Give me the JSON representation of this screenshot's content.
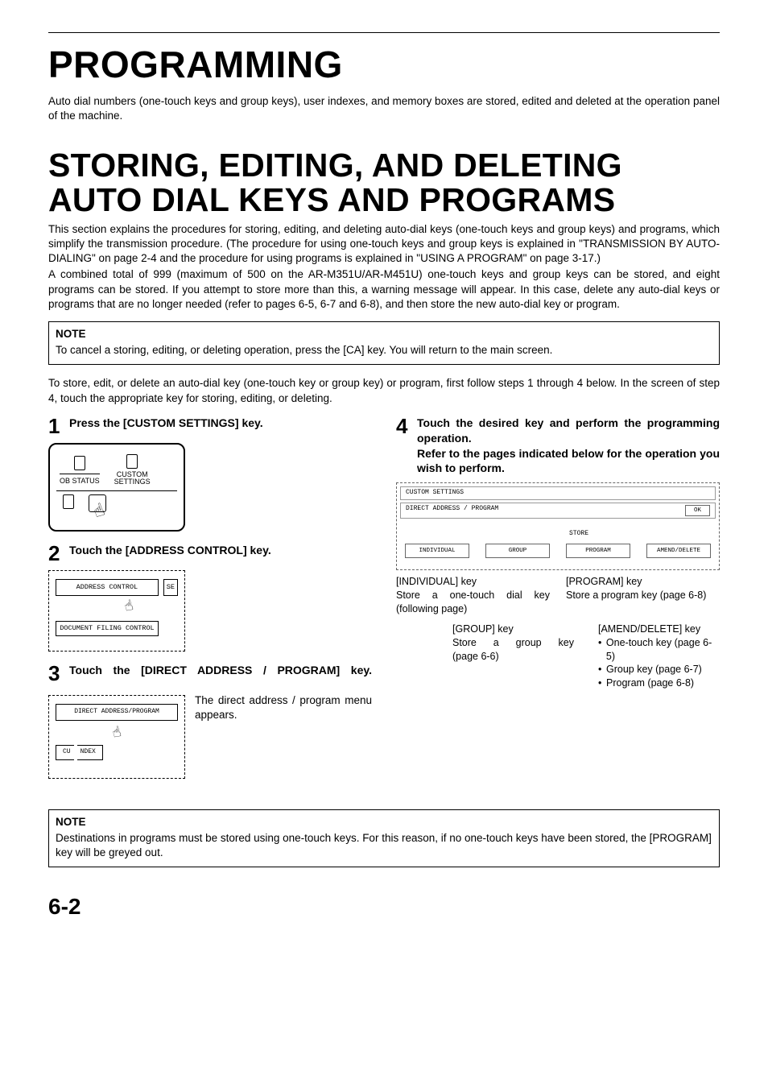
{
  "title": "PROGRAMMING",
  "intro": "Auto dial numbers (one-touch keys and group keys), user indexes, and memory boxes are stored, edited and deleted at the operation panel of the machine.",
  "section_title": "STORING, EDITING, AND DELETING AUTO DIAL KEYS AND PROGRAMS",
  "section_p1": "This section explains the procedures for storing, editing, and deleting auto-dial keys (one-touch keys and group keys) and programs, which simplify the transmission procedure. (The procedure for using one-touch keys and group keys is explained in \"TRANSMISSION BY AUTO-DIALING\" on page 2-4 and the procedure for using programs is explained in \"USING A PROGRAM\" on page 3-17.)",
  "section_p2": "A combined total of 999 (maximum of 500 on the AR-M351U/AR-M451U) one-touch keys and group keys can be stored, and eight programs can be stored. If you attempt to store more than this, a warning message will appear. In this case, delete any auto-dial keys or programs that are no longer needed (refer to pages 6-5, 6-7 and 6-8), and then store the new auto-dial key or program.",
  "note1": {
    "label": "NOTE",
    "text": "To cancel a storing, editing, or deleting operation, press the [CA] key. You will return to the main screen."
  },
  "lead": "To store, edit, or delete an auto-dial key (one-touch key or group key) or program, first follow steps 1 through 4 below. In the screen of step 4, touch the appropriate key for storing, editing, or deleting.",
  "steps": {
    "s1": {
      "num": "1",
      "title": "Press the [CUSTOM SETTINGS] key.",
      "fig": {
        "job_status": "OB STATUS",
        "custom": "CUSTOM\nSETTINGS"
      }
    },
    "s2": {
      "num": "2",
      "title": "Touch the [ADDRESS CONTROL] key.",
      "fig": {
        "btn1": "ADDRESS CONTROL",
        "btn1_side": "SE",
        "btn2": "DOCUMENT FILING CONTROL"
      }
    },
    "s3": {
      "num": "3",
      "title": "Touch the [DIRECT ADDRESS / PROGRAM] key.",
      "note": "The direct address / program menu appears.",
      "fig": {
        "btn1": "DIRECT ADDRESS/PROGRAM",
        "btn2a": "CU",
        "btn2b": "NDEX"
      }
    },
    "s4": {
      "num": "4",
      "title": "Touch the desired key and perform the programming operation.",
      "sub": "Refer to the pages indicated below for the operation you wish to perform.",
      "fig": {
        "hdr": "CUSTOM SETTINGS",
        "tab": "DIRECT ADDRESS / PROGRAM",
        "ok": "OK",
        "store": "STORE",
        "b1": "INDIVIDUAL",
        "b2": "GROUP",
        "b3": "PROGRAM",
        "b4": "AMEND/DELETE"
      },
      "callouts": {
        "individual": {
          "label": "[INDIVIDUAL] key",
          "text": "Store a one-touch dial key (following page)"
        },
        "program": {
          "label": "[PROGRAM] key",
          "text": "Store a program key (page 6-8)"
        },
        "group": {
          "label": "[GROUP] key",
          "text": "Store a group key (page 6-6)"
        },
        "amend": {
          "label": "[AMEND/DELETE] key",
          "items": [
            "One-touch key (page 6-5)",
            "Group key (page 6-7)",
            "Program (page 6-8)"
          ]
        }
      }
    }
  },
  "note2": {
    "label": "NOTE",
    "text": "Destinations in programs must be stored using one-touch keys. For this reason, if no one-touch keys have been stored, the [PROGRAM] key will be greyed out."
  },
  "page_number": "6-2"
}
